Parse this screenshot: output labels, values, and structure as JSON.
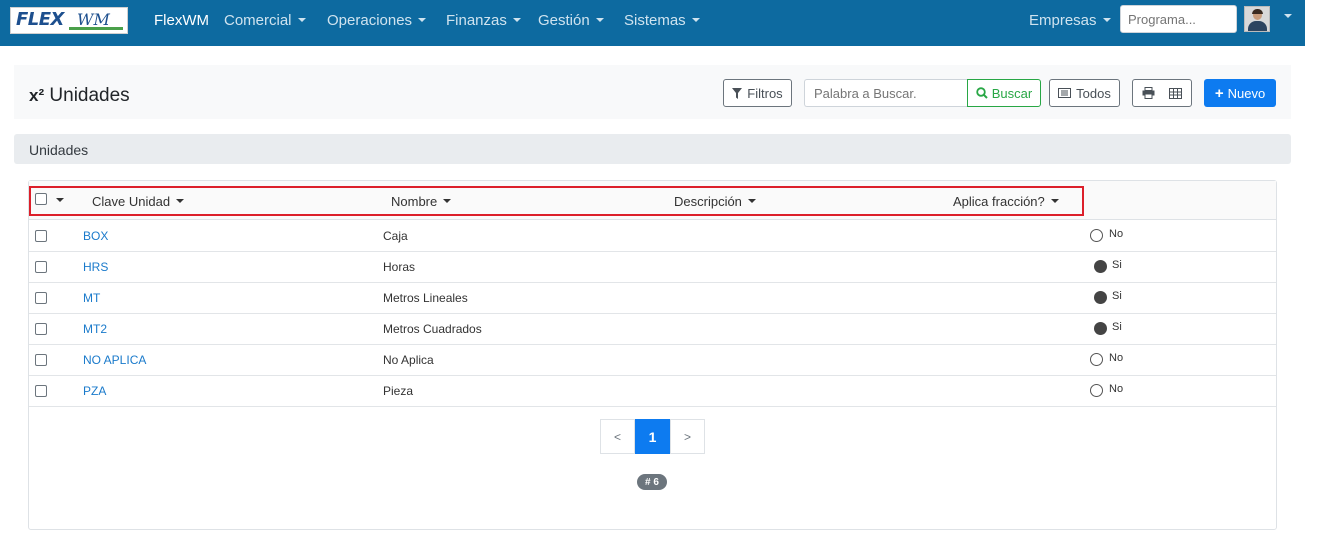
{
  "navbar": {
    "logo_text": "FLEX",
    "logo_suffix": "WM",
    "brand": "FlexWM",
    "menus": [
      "Comercial",
      "Operaciones",
      "Finanzas",
      "Gestión",
      "Sistemas"
    ],
    "right_menu": "Empresas",
    "search_placeholder": "Programa..."
  },
  "header": {
    "title_prefix": "x²",
    "title": "Unidades",
    "filters_label": "Filtros",
    "search_placeholder": "Palabra a Buscar.",
    "search_button": "Buscar",
    "all_button": "Todos",
    "new_button": "Nuevo"
  },
  "section": {
    "title": "Unidades"
  },
  "table": {
    "columns": [
      "Clave Unidad",
      "Nombre",
      "Descripción",
      "Aplica fracción?"
    ],
    "rows": [
      {
        "clave": "BOX",
        "nombre": "Caja",
        "descripcion": "",
        "fraccion": "No",
        "on": false
      },
      {
        "clave": "HRS",
        "nombre": "Horas",
        "descripcion": "",
        "fraccion": "Si",
        "on": true
      },
      {
        "clave": "MT",
        "nombre": "Metros Lineales",
        "descripcion": "",
        "fraccion": "Si",
        "on": true
      },
      {
        "clave": "MT2",
        "nombre": "Metros Cuadrados",
        "descripcion": "",
        "fraccion": "Si",
        "on": true
      },
      {
        "clave": "NO APLICA",
        "nombre": "No Aplica",
        "descripcion": "",
        "fraccion": "No",
        "on": false
      },
      {
        "clave": "PZA",
        "nombre": "Pieza",
        "descripcion": "",
        "fraccion": "No",
        "on": false
      }
    ]
  },
  "pagination": {
    "prev": "<",
    "current": "1",
    "next": ">",
    "count": "# 6"
  },
  "colors": {
    "navbar": "#0d6aa0",
    "primary": "#0d7bf0",
    "success": "#28a745",
    "highlight": "#dc1f2a",
    "link": "#1a7acb"
  }
}
